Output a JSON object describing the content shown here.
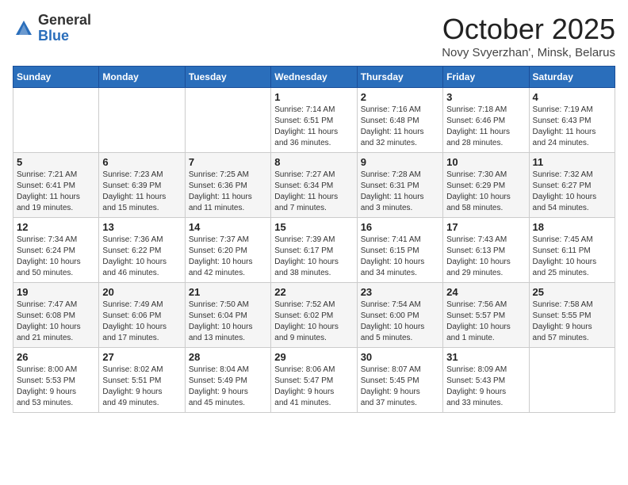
{
  "header": {
    "logo": {
      "general": "General",
      "blue": "Blue"
    },
    "title": "October 2025",
    "subtitle": "Novy Svyerzhan', Minsk, Belarus"
  },
  "columns": [
    "Sunday",
    "Monday",
    "Tuesday",
    "Wednesday",
    "Thursday",
    "Friday",
    "Saturday"
  ],
  "weeks": [
    [
      {
        "day": "",
        "info": ""
      },
      {
        "day": "",
        "info": ""
      },
      {
        "day": "",
        "info": ""
      },
      {
        "day": "1",
        "info": "Sunrise: 7:14 AM\nSunset: 6:51 PM\nDaylight: 11 hours\nand 36 minutes."
      },
      {
        "day": "2",
        "info": "Sunrise: 7:16 AM\nSunset: 6:48 PM\nDaylight: 11 hours\nand 32 minutes."
      },
      {
        "day": "3",
        "info": "Sunrise: 7:18 AM\nSunset: 6:46 PM\nDaylight: 11 hours\nand 28 minutes."
      },
      {
        "day": "4",
        "info": "Sunrise: 7:19 AM\nSunset: 6:43 PM\nDaylight: 11 hours\nand 24 minutes."
      }
    ],
    [
      {
        "day": "5",
        "info": "Sunrise: 7:21 AM\nSunset: 6:41 PM\nDaylight: 11 hours\nand 19 minutes."
      },
      {
        "day": "6",
        "info": "Sunrise: 7:23 AM\nSunset: 6:39 PM\nDaylight: 11 hours\nand 15 minutes."
      },
      {
        "day": "7",
        "info": "Sunrise: 7:25 AM\nSunset: 6:36 PM\nDaylight: 11 hours\nand 11 minutes."
      },
      {
        "day": "8",
        "info": "Sunrise: 7:27 AM\nSunset: 6:34 PM\nDaylight: 11 hours\nand 7 minutes."
      },
      {
        "day": "9",
        "info": "Sunrise: 7:28 AM\nSunset: 6:31 PM\nDaylight: 11 hours\nand 3 minutes."
      },
      {
        "day": "10",
        "info": "Sunrise: 7:30 AM\nSunset: 6:29 PM\nDaylight: 10 hours\nand 58 minutes."
      },
      {
        "day": "11",
        "info": "Sunrise: 7:32 AM\nSunset: 6:27 PM\nDaylight: 10 hours\nand 54 minutes."
      }
    ],
    [
      {
        "day": "12",
        "info": "Sunrise: 7:34 AM\nSunset: 6:24 PM\nDaylight: 10 hours\nand 50 minutes."
      },
      {
        "day": "13",
        "info": "Sunrise: 7:36 AM\nSunset: 6:22 PM\nDaylight: 10 hours\nand 46 minutes."
      },
      {
        "day": "14",
        "info": "Sunrise: 7:37 AM\nSunset: 6:20 PM\nDaylight: 10 hours\nand 42 minutes."
      },
      {
        "day": "15",
        "info": "Sunrise: 7:39 AM\nSunset: 6:17 PM\nDaylight: 10 hours\nand 38 minutes."
      },
      {
        "day": "16",
        "info": "Sunrise: 7:41 AM\nSunset: 6:15 PM\nDaylight: 10 hours\nand 34 minutes."
      },
      {
        "day": "17",
        "info": "Sunrise: 7:43 AM\nSunset: 6:13 PM\nDaylight: 10 hours\nand 29 minutes."
      },
      {
        "day": "18",
        "info": "Sunrise: 7:45 AM\nSunset: 6:11 PM\nDaylight: 10 hours\nand 25 minutes."
      }
    ],
    [
      {
        "day": "19",
        "info": "Sunrise: 7:47 AM\nSunset: 6:08 PM\nDaylight: 10 hours\nand 21 minutes."
      },
      {
        "day": "20",
        "info": "Sunrise: 7:49 AM\nSunset: 6:06 PM\nDaylight: 10 hours\nand 17 minutes."
      },
      {
        "day": "21",
        "info": "Sunrise: 7:50 AM\nSunset: 6:04 PM\nDaylight: 10 hours\nand 13 minutes."
      },
      {
        "day": "22",
        "info": "Sunrise: 7:52 AM\nSunset: 6:02 PM\nDaylight: 10 hours\nand 9 minutes."
      },
      {
        "day": "23",
        "info": "Sunrise: 7:54 AM\nSunset: 6:00 PM\nDaylight: 10 hours\nand 5 minutes."
      },
      {
        "day": "24",
        "info": "Sunrise: 7:56 AM\nSunset: 5:57 PM\nDaylight: 10 hours\nand 1 minute."
      },
      {
        "day": "25",
        "info": "Sunrise: 7:58 AM\nSunset: 5:55 PM\nDaylight: 9 hours\nand 57 minutes."
      }
    ],
    [
      {
        "day": "26",
        "info": "Sunrise: 8:00 AM\nSunset: 5:53 PM\nDaylight: 9 hours\nand 53 minutes."
      },
      {
        "day": "27",
        "info": "Sunrise: 8:02 AM\nSunset: 5:51 PM\nDaylight: 9 hours\nand 49 minutes."
      },
      {
        "day": "28",
        "info": "Sunrise: 8:04 AM\nSunset: 5:49 PM\nDaylight: 9 hours\nand 45 minutes."
      },
      {
        "day": "29",
        "info": "Sunrise: 8:06 AM\nSunset: 5:47 PM\nDaylight: 9 hours\nand 41 minutes."
      },
      {
        "day": "30",
        "info": "Sunrise: 8:07 AM\nSunset: 5:45 PM\nDaylight: 9 hours\nand 37 minutes."
      },
      {
        "day": "31",
        "info": "Sunrise: 8:09 AM\nSunset: 5:43 PM\nDaylight: 9 hours\nand 33 minutes."
      },
      {
        "day": "",
        "info": ""
      }
    ]
  ]
}
